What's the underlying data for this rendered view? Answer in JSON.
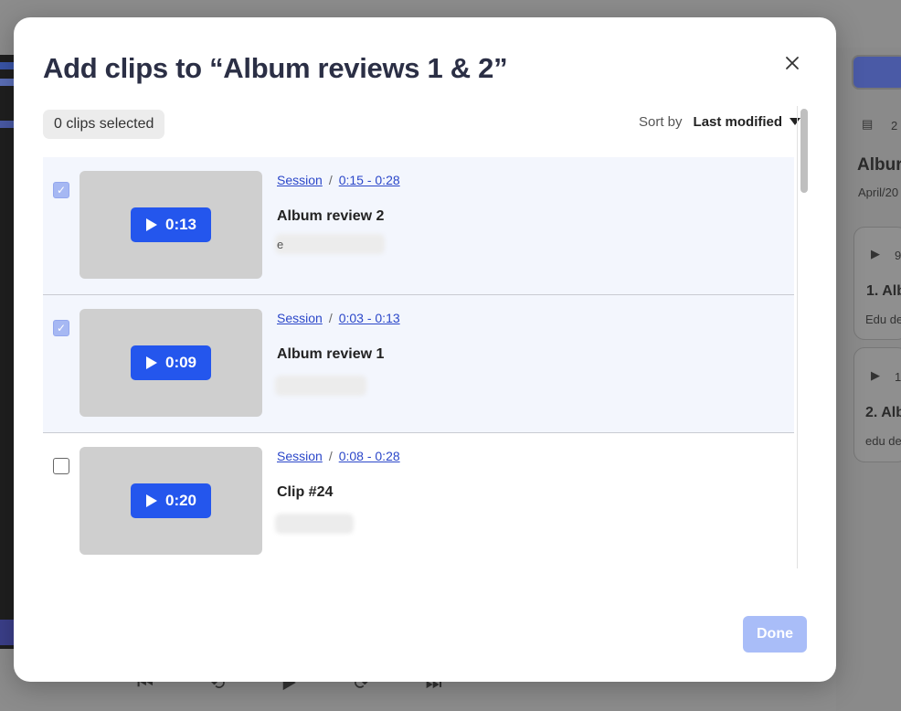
{
  "modal": {
    "title": "Add clips to “Album reviews 1 & 2”",
    "selected_count_label": "0 clips selected",
    "sort": {
      "label": "Sort by",
      "value": "Last modified"
    },
    "done_label": "Done",
    "clips": [
      {
        "selected": true,
        "source": "Session",
        "range": "0:15 - 0:28",
        "duration": "0:13",
        "title": "Album review 2",
        "subtitle": "e"
      },
      {
        "selected": true,
        "source": "Session",
        "range": "0:03 - 0:13",
        "duration": "0:09",
        "title": "Album review 1",
        "subtitle": ""
      },
      {
        "selected": false,
        "source": "Session",
        "range": "0:08 - 0:28",
        "duration": "0:20",
        "title": "Clip #24",
        "subtitle": ""
      }
    ]
  },
  "background_panel": {
    "count": "2",
    "title": "Albur",
    "date": "April/20",
    "cards": [
      {
        "time": "9",
        "title": "1. Alb",
        "desc": "Edu de"
      },
      {
        "time": "1",
        "title": "2. Alb",
        "desc": "edu de"
      }
    ]
  },
  "colors": {
    "accent": "#2456ed",
    "done_disabled": "#a9bdf8",
    "row_selected": "#f3f6fd",
    "title": "#2b2f45"
  }
}
